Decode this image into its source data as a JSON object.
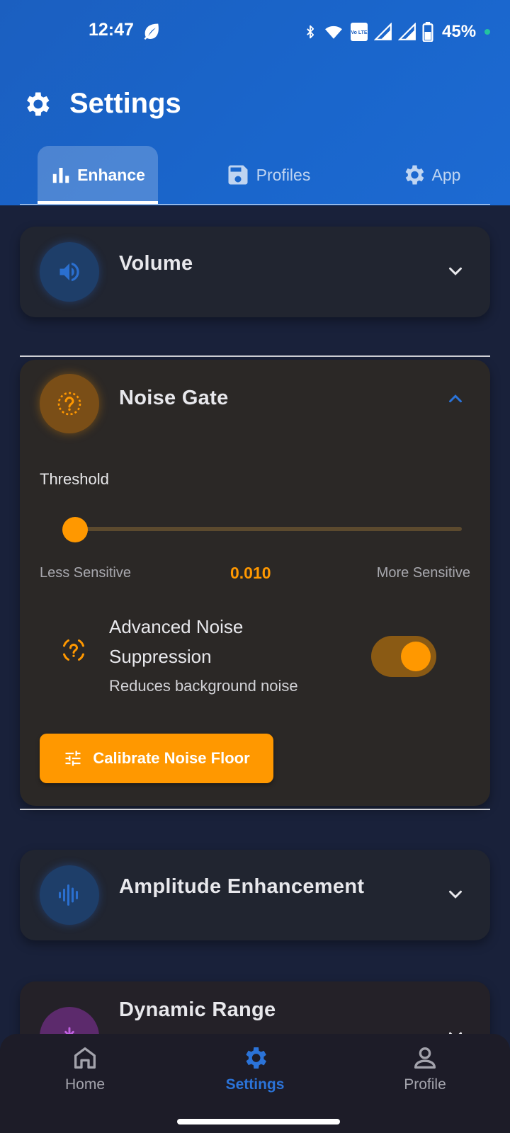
{
  "status_bar": {
    "time": "12:47",
    "battery": "45%",
    "lte_label": "Vo LTE"
  },
  "header": {
    "title": "Settings"
  },
  "tabs": [
    {
      "label": "Enhance",
      "icon": "bar-chart-icon",
      "active": true
    },
    {
      "label": "Profiles",
      "icon": "save-icon",
      "active": false
    },
    {
      "label": "App",
      "icon": "gear-icon",
      "active": false
    }
  ],
  "cards": {
    "volume": {
      "title": "Volume",
      "icon": "speaker-icon",
      "expanded": false
    },
    "noise_gate": {
      "title": "Noise Gate",
      "icon": "noise-gate-icon",
      "expanded": true,
      "threshold_label": "Threshold",
      "slider": {
        "min_label": "Less Sensitive",
        "max_label": "More Sensitive",
        "value": "0.010",
        "fraction": 0.0
      },
      "advanced": {
        "title": "Advanced Noise Suppression",
        "subtitle": "Reduces background noise",
        "enabled": true
      },
      "calibrate_label": "Calibrate Noise Floor"
    },
    "amplitude": {
      "title": "Amplitude Enhancement",
      "icon": "waveform-icon",
      "expanded": false
    },
    "dynamic_range": {
      "title": "Dynamic Range",
      "icon": "compress-icon",
      "expanded": false
    }
  },
  "bottom_nav": [
    {
      "label": "Home",
      "icon": "home-icon",
      "active": false
    },
    {
      "label": "Settings",
      "icon": "gear-icon",
      "active": true
    },
    {
      "label": "Profile",
      "icon": "person-icon",
      "active": false
    }
  ],
  "colors": {
    "header_blue": "#1b62c7",
    "accent_orange": "#ff9800",
    "accent_blue": "#2b73d8",
    "background": "#19213a"
  }
}
